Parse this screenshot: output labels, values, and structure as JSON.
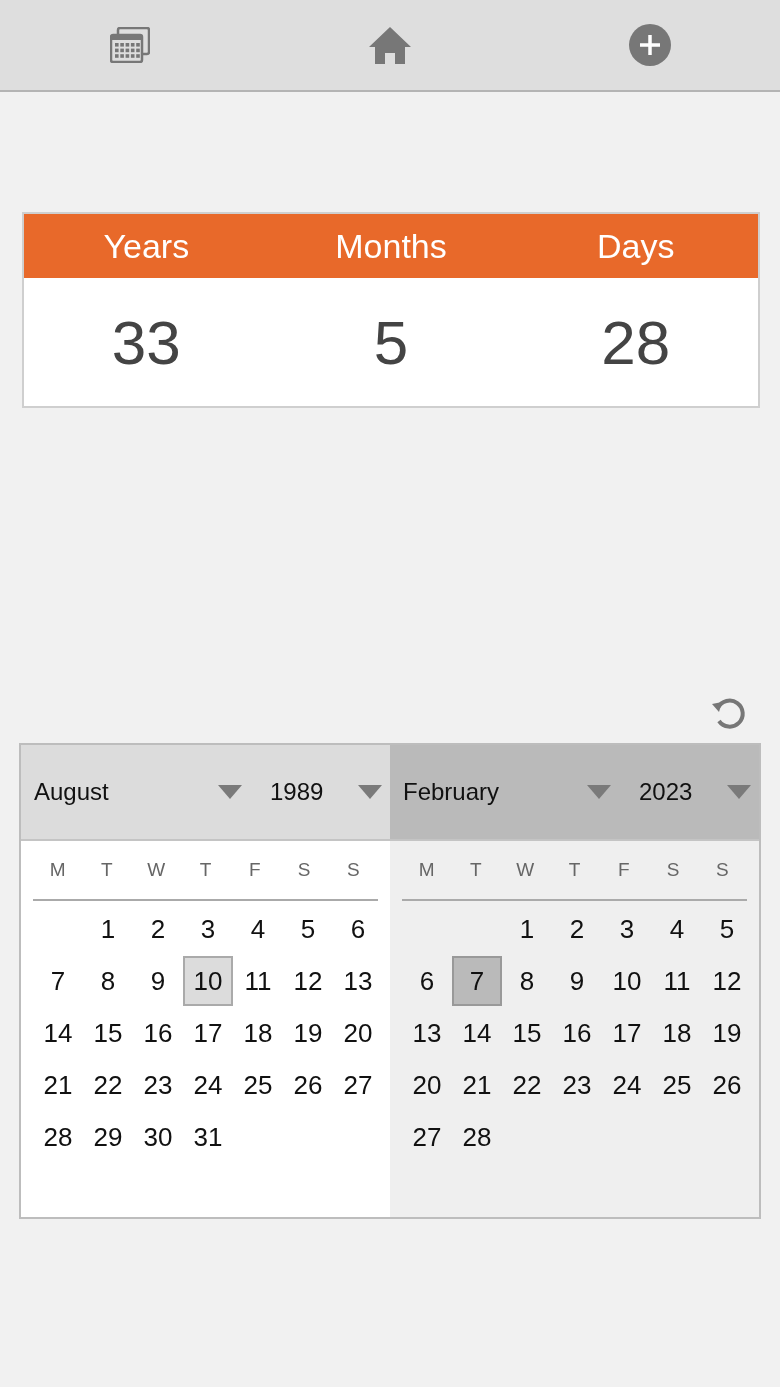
{
  "toolbar": {
    "buttons": [
      {
        "kind": "calendars"
      },
      {
        "kind": "home"
      },
      {
        "kind": "add"
      }
    ]
  },
  "result": {
    "columns": [
      {
        "label": "Years",
        "value": "33"
      },
      {
        "label": "Months",
        "value": "5"
      },
      {
        "label": "Days",
        "value": "28"
      }
    ]
  },
  "calendars": [
    {
      "kind": "start",
      "month": "August",
      "year": "1989",
      "weekdays": [
        "M",
        "T",
        "W",
        "T",
        "F",
        "S",
        "S"
      ],
      "weeks": [
        {
          "right_aligned": true,
          "days": [
            {
              "label": "1",
              "selected": false
            },
            {
              "label": "2",
              "selected": false
            },
            {
              "label": "3",
              "selected": false
            },
            {
              "label": "4",
              "selected": false
            },
            {
              "label": "5",
              "selected": false
            },
            {
              "label": "6",
              "selected": false
            }
          ]
        },
        {
          "days": [
            {
              "label": "7",
              "selected": false
            },
            {
              "label": "8",
              "selected": false
            },
            {
              "label": "9",
              "selected": false
            },
            {
              "label": "10",
              "selected": true
            },
            {
              "label": "11",
              "selected": false
            },
            {
              "label": "12",
              "selected": false
            },
            {
              "label": "13",
              "selected": false
            }
          ]
        },
        {
          "days": [
            {
              "label": "14",
              "selected": false
            },
            {
              "label": "15",
              "selected": false
            },
            {
              "label": "16",
              "selected": false
            },
            {
              "label": "17",
              "selected": false
            },
            {
              "label": "18",
              "selected": false
            },
            {
              "label": "19",
              "selected": false
            },
            {
              "label": "20",
              "selected": false
            }
          ]
        },
        {
          "days": [
            {
              "label": "21",
              "selected": false
            },
            {
              "label": "22",
              "selected": false
            },
            {
              "label": "23",
              "selected": false
            },
            {
              "label": "24",
              "selected": false
            },
            {
              "label": "25",
              "selected": false
            },
            {
              "label": "26",
              "selected": false
            },
            {
              "label": "27",
              "selected": false
            }
          ]
        },
        {
          "right_aligned": false,
          "days": [
            {
              "label": "28",
              "selected": false
            },
            {
              "label": "29",
              "selected": false
            },
            {
              "label": "30",
              "selected": false
            },
            {
              "label": "31",
              "selected": false
            }
          ]
        }
      ]
    },
    {
      "kind": "end",
      "month": "February",
      "year": "2023",
      "weekdays": [
        "M",
        "T",
        "W",
        "T",
        "F",
        "S",
        "S"
      ],
      "weeks": [
        {
          "right_aligned": true,
          "days": [
            {
              "label": "1",
              "selected": false
            },
            {
              "label": "2",
              "selected": false
            },
            {
              "label": "3",
              "selected": false
            },
            {
              "label": "4",
              "selected": false
            },
            {
              "label": "5",
              "selected": false
            }
          ]
        },
        {
          "days": [
            {
              "label": "6",
              "selected": false
            },
            {
              "label": "7",
              "selected": true
            },
            {
              "label": "8",
              "selected": false
            },
            {
              "label": "9",
              "selected": false
            },
            {
              "label": "10",
              "selected": false
            },
            {
              "label": "11",
              "selected": false
            },
            {
              "label": "12",
              "selected": false
            }
          ]
        },
        {
          "days": [
            {
              "label": "13",
              "selected": false
            },
            {
              "label": "14",
              "selected": false
            },
            {
              "label": "15",
              "selected": false
            },
            {
              "label": "16",
              "selected": false
            },
            {
              "label": "17",
              "selected": false
            },
            {
              "label": "18",
              "selected": false
            },
            {
              "label": "19",
              "selected": false
            }
          ]
        },
        {
          "days": [
            {
              "label": "20",
              "selected": false
            },
            {
              "label": "21",
              "selected": false
            },
            {
              "label": "22",
              "selected": false
            },
            {
              "label": "23",
              "selected": false
            },
            {
              "label": "24",
              "selected": false
            },
            {
              "label": "25",
              "selected": false
            },
            {
              "label": "26",
              "selected": false
            }
          ]
        },
        {
          "right_aligned": false,
          "days": [
            {
              "label": "27",
              "selected": false
            },
            {
              "label": "28",
              "selected": false
            }
          ]
        }
      ]
    }
  ]
}
